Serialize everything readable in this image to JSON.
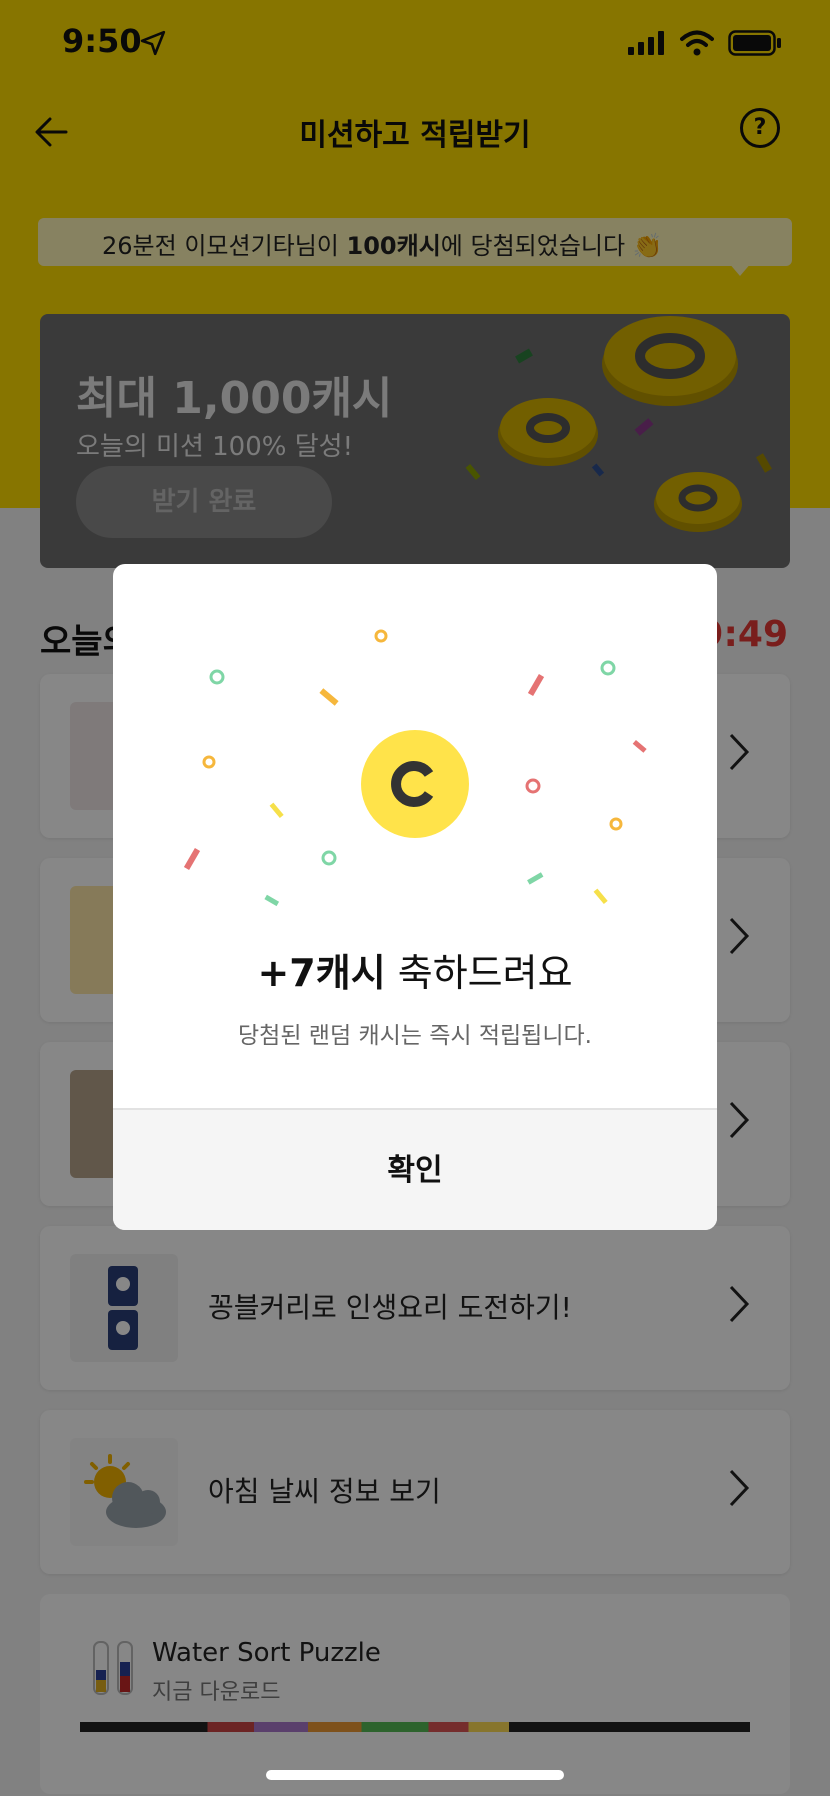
{
  "status": {
    "time": "9:50"
  },
  "header": {
    "title": "미션하고 적립받기",
    "help": "?"
  },
  "ticker": {
    "prefix": "26분전 이모션기타님이 ",
    "highlight": "100캐시",
    "suffix": "에 당첨되었습니다 👏"
  },
  "promo": {
    "title": "최대 1,000캐시",
    "subtitle": "오늘의 미션 100% 달성!",
    "button": "받기 완료"
  },
  "section": {
    "title": "오늘의",
    "timer": "9:49"
  },
  "missions": [
    {
      "label": ""
    },
    {
      "label": ""
    },
    {
      "label": ""
    },
    {
      "label": "꽁블커리로 인생요리 도전하기!"
    },
    {
      "label": "아침 날씨 정보 보기"
    }
  ],
  "ad": {
    "title": "Water Sort Puzzle",
    "subtitle": "지금 다운로드"
  },
  "modal": {
    "amount": "+7캐시",
    "title_suffix": " 축하드려요",
    "description": "당첨된 랜덤 캐시는 즉시 적립됩니다.",
    "confirm": "확인"
  },
  "colors": {
    "brand_yellow": "#ffdd00",
    "coin_yellow": "#ffe34a",
    "timer_red": "#e53935"
  }
}
